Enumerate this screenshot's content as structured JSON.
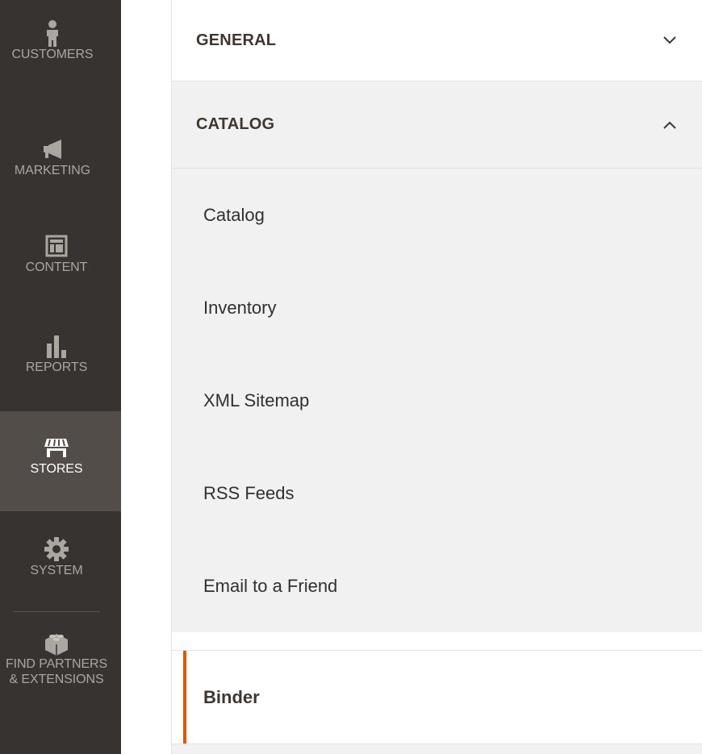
{
  "left_nav": {
    "items": [
      {
        "label": "CUSTOMERS",
        "icon": "person-icon",
        "active": false
      },
      {
        "label": "MARKETING",
        "icon": "megaphone-icon",
        "active": false
      },
      {
        "label": "CONTENT",
        "icon": "layout-icon",
        "active": false
      },
      {
        "label": "REPORTS",
        "icon": "bar-chart-icon",
        "active": false
      },
      {
        "label": "STORES",
        "icon": "storefront-icon",
        "active": true
      },
      {
        "label": "SYSTEM",
        "icon": "gear-icon",
        "active": false
      },
      {
        "label": "FIND PARTNERS",
        "label2": "& EXTENSIONS",
        "icon": "lego-brick-icon",
        "active": false
      }
    ]
  },
  "config_tabs": {
    "general": {
      "title": "GENERAL",
      "expanded": false
    },
    "catalog": {
      "title": "CATALOG",
      "expanded": true,
      "items": [
        {
          "label": "Catalog"
        },
        {
          "label": "Inventory"
        },
        {
          "label": "XML Sitemap"
        },
        {
          "label": "RSS Feeds"
        },
        {
          "label": "Email to a Friend"
        },
        {
          "label": "Binder",
          "current": true
        }
      ]
    }
  },
  "colors": {
    "nav_bg": "#373330",
    "nav_active_bg": "#524d49",
    "nav_text": "#aaa6a0",
    "panel_bg": "#f1f1f1",
    "heading_text": "#41362f",
    "accent": "#eb5202"
  }
}
